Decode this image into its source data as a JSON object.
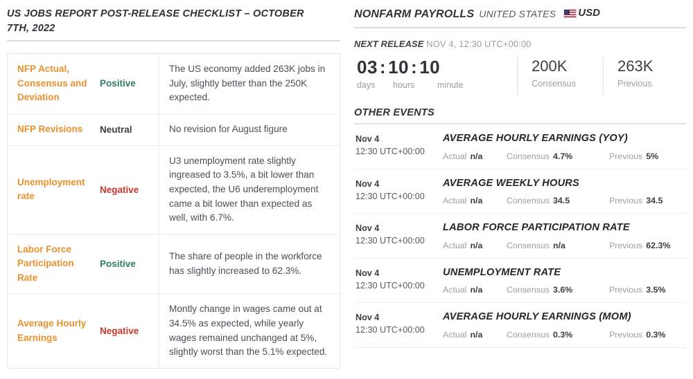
{
  "left": {
    "title": "US JOBS REPORT POST-RELEASE CHECKLIST – OCTOBER 7TH, 2022",
    "checklist": [
      {
        "name": "NFP Actual, Consensus and Deviation",
        "verdict": "Positive",
        "verdict_kind": "positive",
        "description": "The US economy added 263K jobs in July, slightly better than the 250K expected."
      },
      {
        "name": "NFP Revisions",
        "verdict": "Neutral",
        "verdict_kind": "neutral",
        "description": "No revision for August figure"
      },
      {
        "name": "Unemployment rate",
        "verdict": "Negative",
        "verdict_kind": "negative",
        "description": "U3 unemployment rate slightly ingreased to 3.5%, a bit lower than expected, the U6 underemployment came a bit lower than expected as well, with 6.7%."
      },
      {
        "name": "Labor Force Participation Rate",
        "verdict": "Positive",
        "verdict_kind": "positive",
        "description": "The share of people in the workforce has slightly increased to 62.3%."
      },
      {
        "name": "Average Hourly Earnings",
        "verdict": "Negative",
        "verdict_kind": "negative",
        "description": "Montly change in wages came out at 34.5% as expected, while yearly wages remained unchanged at 5%, slightly worst than the 5.1% expected."
      }
    ]
  },
  "right": {
    "header": {
      "title": "NONFARM PAYROLLS",
      "country": "UNITED STATES",
      "currency": "USD",
      "flag_icon": "us-flag-icon"
    },
    "next_release": {
      "label": "NEXT RELEASE",
      "value": "NOV 4, 12:30 UTC+00:00"
    },
    "countdown": {
      "days": "03",
      "hours": "10",
      "minutes": "10",
      "separator": ":",
      "label_days": "days",
      "label_hours": "hours",
      "label_minutes": "minute"
    },
    "stats": {
      "consensus_value": "200K",
      "consensus_label": "Consensus",
      "previous_value": "263K",
      "previous_label": "Previous"
    },
    "other_events_heading": "OTHER EVENTS",
    "stat_labels": {
      "actual": "Actual",
      "consensus": "Consensus",
      "previous": "Previous"
    },
    "events": [
      {
        "day": "Nov 4",
        "time": "12:30 UTC+00:00",
        "title": "AVERAGE HOURLY EARNINGS (YOY)",
        "actual": "n/a",
        "consensus": "4.7%",
        "previous": "5%"
      },
      {
        "day": "Nov 4",
        "time": "12:30 UTC+00:00",
        "title": "AVERAGE WEEKLY HOURS",
        "actual": "n/a",
        "consensus": "34.5",
        "previous": "34.5"
      },
      {
        "day": "Nov 4",
        "time": "12:30 UTC+00:00",
        "title": "LABOR FORCE PARTICIPATION RATE",
        "actual": "n/a",
        "consensus": "n/a",
        "previous": "62.3%"
      },
      {
        "day": "Nov 4",
        "time": "12:30 UTC+00:00",
        "title": "UNEMPLOYMENT RATE",
        "actual": "n/a",
        "consensus": "3.6%",
        "previous": "3.5%"
      },
      {
        "day": "Nov 4",
        "time": "12:30 UTC+00:00",
        "title": "AVERAGE HOURLY EARNINGS (MOM)",
        "actual": "n/a",
        "consensus": "0.3%",
        "previous": "0.3%"
      }
    ]
  },
  "colors": {
    "accent_orange": "#e8912d",
    "positive_green": "#2e7c68",
    "negative_red": "#c9372c",
    "neutral_gray": "#3b3f44",
    "text_dark": "#2f3337",
    "text_muted": "#9aa0a6"
  }
}
